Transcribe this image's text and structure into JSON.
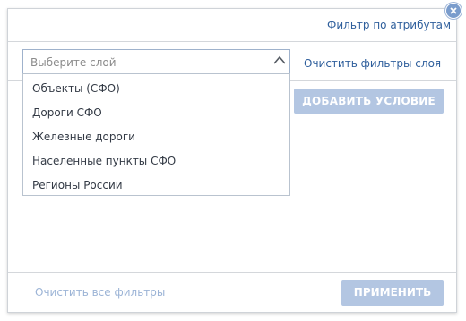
{
  "dialog": {
    "title": "Фильтр по атрибутам",
    "close_icon": "close-icon"
  },
  "layer_select": {
    "placeholder": "Выберите слой",
    "chevron_icon": "chevron-up-icon",
    "options": [
      "Объекты (СФО)",
      "Дороги СФО",
      "Железные дороги",
      "Населенные пункты СФО",
      "Регионы России"
    ]
  },
  "toolbar": {
    "clear_layer_filters": "Очистить фильтры слоя",
    "add_condition": "ДОБАВИТЬ УСЛОВИЕ"
  },
  "footer": {
    "clear_all_filters": "Очистить все фильтры",
    "apply": "ПРИМЕНИТЬ"
  },
  "colors": {
    "link": "#2f5f9c",
    "button_disabled_bg": "#b3c6e2",
    "close_bg": "#7a9ccc"
  }
}
